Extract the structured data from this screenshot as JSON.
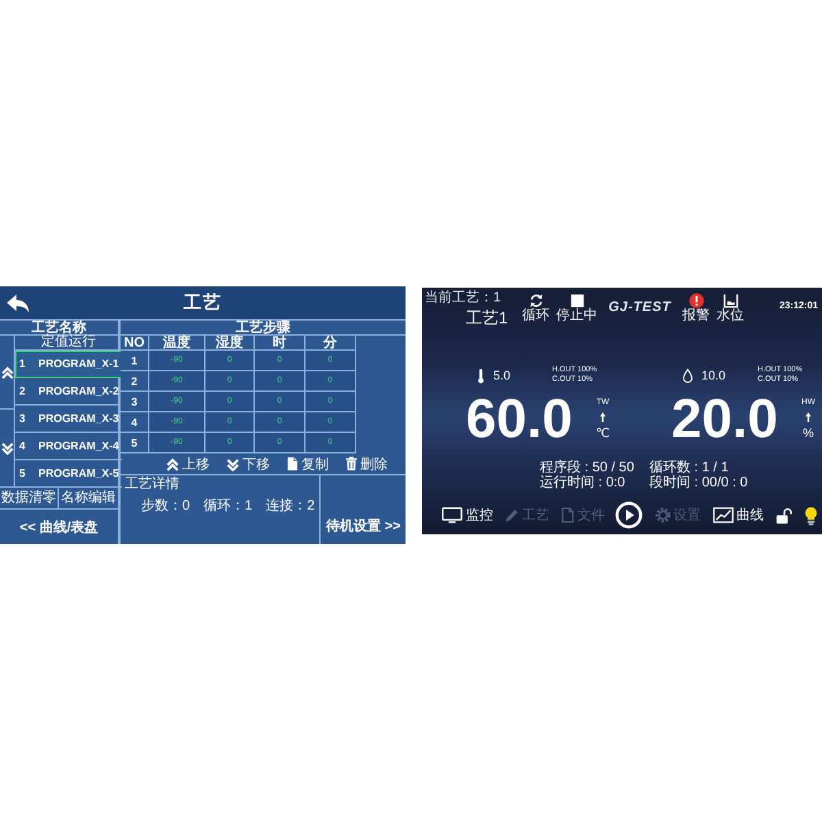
{
  "process_screen": {
    "title": "工艺",
    "program_list": {
      "header": "工艺名称",
      "mode": "定值运行",
      "items": [
        {
          "number": "1",
          "name": "PROGRAM_X-1",
          "selected": true
        },
        {
          "number": "2",
          "name": "PROGRAM_X-2",
          "selected": false
        },
        {
          "number": "3",
          "name": "PROGRAM_X-3",
          "selected": false
        },
        {
          "number": "4",
          "name": "PROGRAM_X-4",
          "selected": false
        },
        {
          "number": "5",
          "name": "PROGRAM_X-5",
          "selected": false
        }
      ]
    },
    "list_buttons": [
      "数据清零",
      "名称编辑"
    ],
    "view_switch": "<< 曲线/表盘",
    "steps_table": {
      "header": "工艺步骤",
      "columns": [
        "NO",
        "温度",
        "湿度",
        "时",
        "分"
      ],
      "rows": [
        [
          "1",
          "-90",
          "0",
          "0",
          "0"
        ],
        [
          "2",
          "-90",
          "0",
          "0",
          "0"
        ],
        [
          "3",
          "-90",
          "0",
          "0",
          "0"
        ],
        [
          "4",
          "-90",
          "0",
          "0",
          "0"
        ],
        [
          "5",
          "-90",
          "0",
          "0",
          "0"
        ]
      ]
    },
    "step_actions": [
      {
        "kind": "up",
        "label": "上移"
      },
      {
        "kind": "down",
        "label": "下移"
      },
      {
        "kind": "copy",
        "label": "复制"
      },
      {
        "kind": "delete",
        "label": "删除"
      }
    ],
    "details": {
      "title": "工艺详情",
      "fields": [
        "步数：0",
        "循环：1",
        "连接：2"
      ]
    },
    "settings_link": "待机设置 >>"
  },
  "monitor_screen": {
    "current_process": "当前工艺：1",
    "process_name": "工艺1",
    "status_indicators": [
      {
        "kind": "cycle",
        "label": "循环"
      },
      {
        "kind": "stop",
        "label": "停止中"
      }
    ],
    "logo": "GJ-TEST",
    "alerts": [
      {
        "kind": "alarm",
        "label": "报警"
      },
      {
        "kind": "water",
        "label": "水位"
      }
    ],
    "time": "23:12:01",
    "gauges": [
      {
        "kind": "temperature",
        "setpoint": "5.0",
        "h_out": "H.OUT 100%",
        "c_out": "C.OUT 10%",
        "value": "60.0",
        "sensor": "TW",
        "unit": "℃"
      },
      {
        "kind": "humidity",
        "setpoint": "10.0",
        "h_out": "H.OUT 100%",
        "c_out": "C.OUT 10%",
        "value": "20.0",
        "sensor": "HW",
        "unit": "%"
      }
    ],
    "counters": [
      [
        "程序段 : 50 / 50",
        "运行时间 : 0:0"
      ],
      [
        "循环数 : 1 / 1",
        "段时间 : 00/0 : 0"
      ]
    ],
    "nav": [
      {
        "kind": "monitor",
        "label": "监控",
        "disabled": false
      },
      {
        "kind": "edit",
        "label": "工艺",
        "disabled": true
      },
      {
        "kind": "file",
        "label": "文件",
        "disabled": true
      },
      {
        "kind": "play",
        "disabled": false
      },
      {
        "kind": "settings",
        "label": "设置",
        "disabled": true
      },
      {
        "kind": "chart",
        "label": "曲线",
        "disabled": false
      }
    ],
    "lock": {
      "locked": false
    },
    "light": {
      "on": true
    }
  }
}
